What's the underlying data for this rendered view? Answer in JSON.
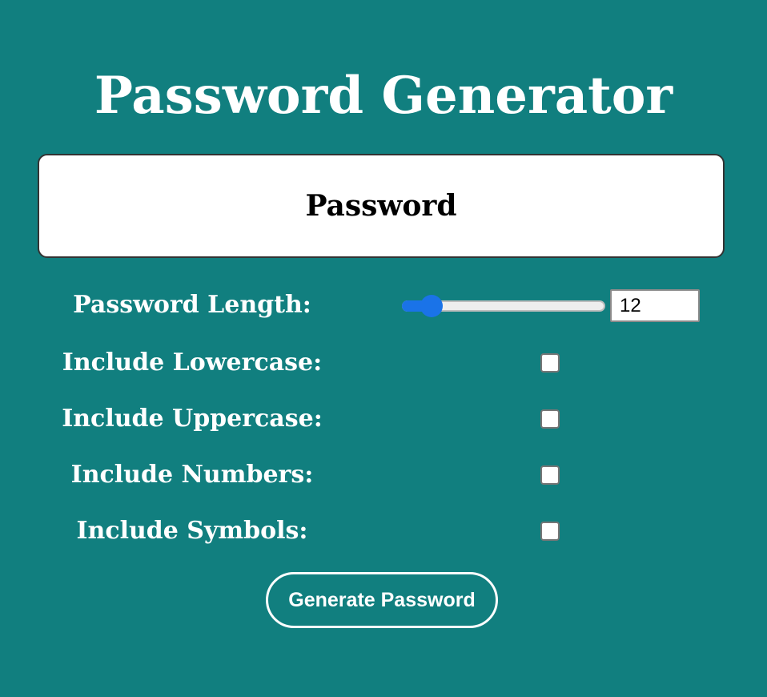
{
  "app": {
    "title": "Password Generator"
  },
  "password_display": {
    "text": "Password"
  },
  "length_option": {
    "label": "Password Length:",
    "value": "12",
    "slider_fraction": 0.08
  },
  "options": [
    {
      "label": "Include Lowercase:",
      "checked": false
    },
    {
      "label": "Include Uppercase:",
      "checked": false
    },
    {
      "label": "Include Numbers:",
      "checked": false
    },
    {
      "label": "Include Symbols:",
      "checked": false
    }
  ],
  "actions": {
    "generate_label": "Generate Password"
  },
  "colors": {
    "background": "#117f7f",
    "accent": "#1a73e8",
    "text": "#ffffff"
  }
}
